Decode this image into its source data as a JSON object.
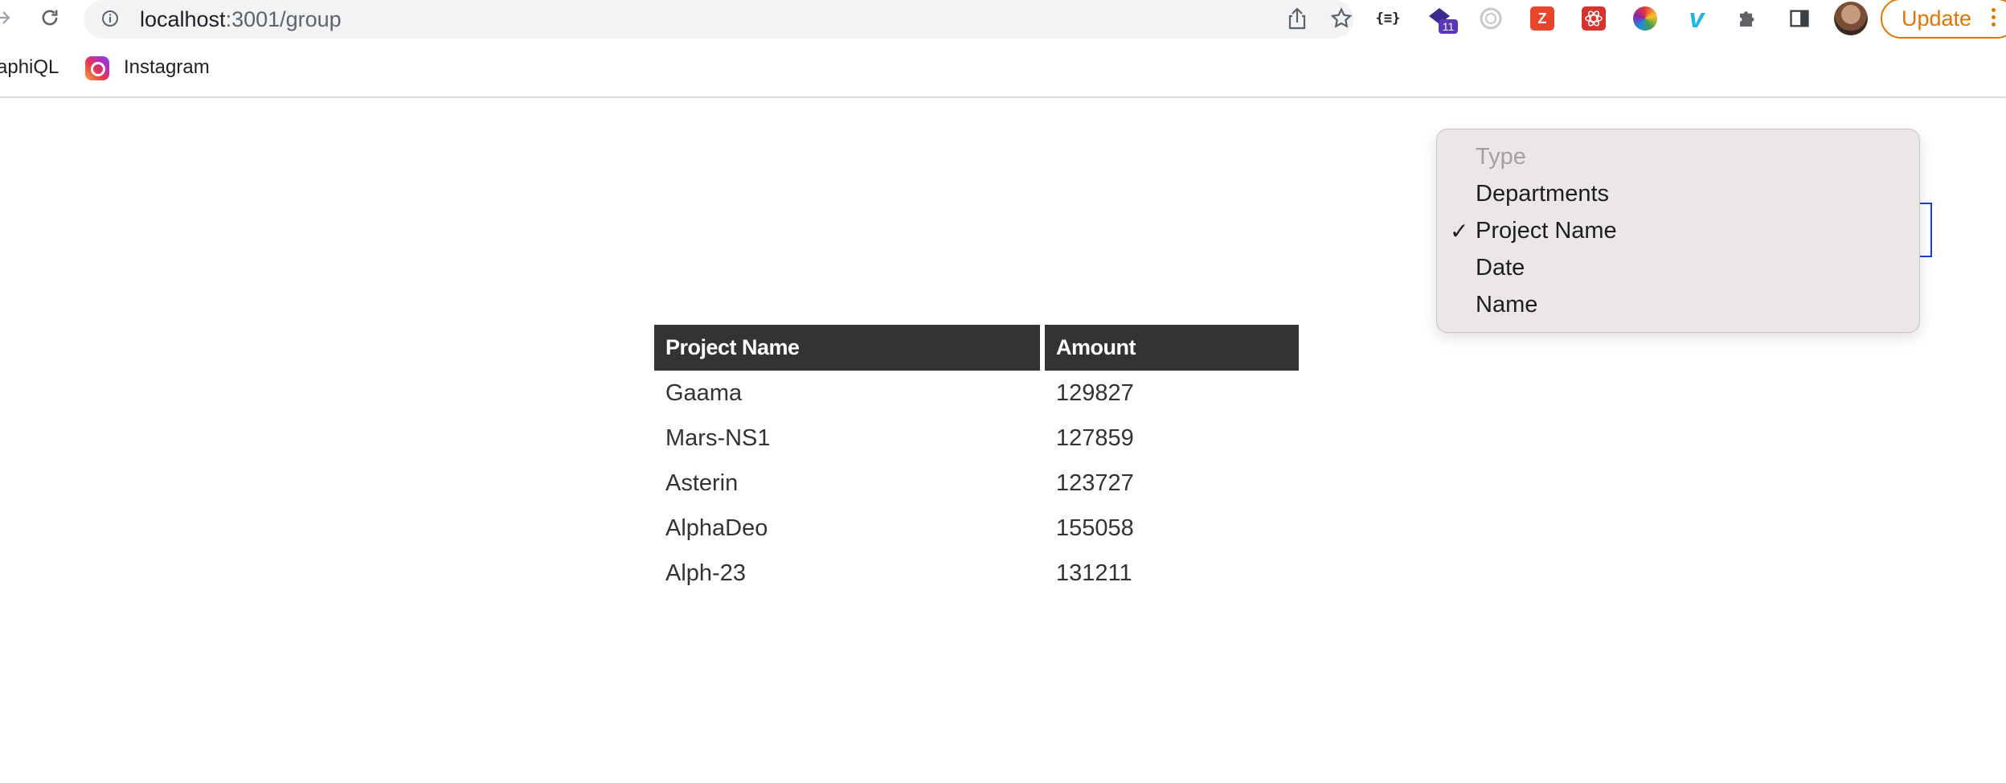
{
  "browser": {
    "url_host": "localhost",
    "url_path": ":3001/group",
    "update_label": "Update",
    "extension_badge": "11"
  },
  "bookmarks": [
    {
      "label": "aphiQL"
    },
    {
      "label": "Instagram"
    }
  ],
  "table": {
    "headers": [
      "Project Name",
      "Amount"
    ],
    "rows": [
      [
        "Gaama",
        "129827"
      ],
      [
        "Mars-NS1",
        "127859"
      ],
      [
        "Asterin",
        "123727"
      ],
      [
        "AlphaDeo",
        "155058"
      ],
      [
        "Alph-23",
        "131211"
      ]
    ]
  },
  "group_select": {
    "selected": "Project Name",
    "options": [
      {
        "label": "Type",
        "disabled": true
      },
      {
        "label": "Departments"
      },
      {
        "label": "Project Name",
        "checked": true
      },
      {
        "label": "Date"
      },
      {
        "label": "Name"
      }
    ]
  },
  "colors": {
    "header_bg": "#333333",
    "update_accent": "#e37400",
    "select_border": "#1a3fd6"
  }
}
